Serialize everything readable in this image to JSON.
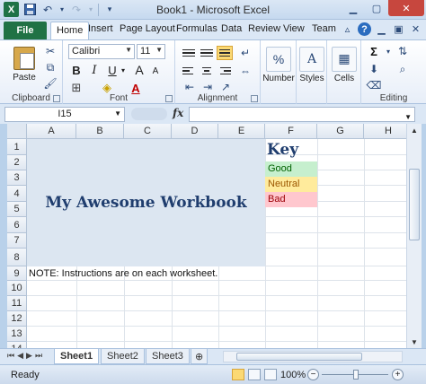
{
  "window": {
    "title": "Book1 - Microsoft Excel",
    "app_icon_letter": "X"
  },
  "tabs": [
    "File",
    "Home",
    "Insert",
    "Page Layout",
    "Formulas",
    "Data",
    "Review",
    "View",
    "Team"
  ],
  "ribbon": {
    "clipboard": {
      "label": "Clipboard",
      "paste_label": "Paste"
    },
    "font": {
      "label": "Font",
      "font_name": "Calibri",
      "font_size": "11",
      "bold": "B",
      "italic": "I",
      "underline": "U",
      "grow": "A",
      "shrink": "A",
      "font_color": "A"
    },
    "alignment": {
      "label": "Alignment"
    },
    "number": {
      "label": "Number",
      "icon_glyph": "%"
    },
    "styles": {
      "label": "Styles",
      "icon_glyph": "A"
    },
    "cells": {
      "label": "Cells"
    },
    "editing": {
      "label": "Editing",
      "sum_glyph": "Σ"
    }
  },
  "formula_bar": {
    "name_box": "I15",
    "fx": "fx",
    "value": ""
  },
  "grid": {
    "columns": [
      "A",
      "B",
      "C",
      "D",
      "E",
      "F",
      "G",
      "H"
    ],
    "rows": [
      "1",
      "2",
      "3",
      "4",
      "5",
      "6",
      "7",
      "8",
      "9",
      "10",
      "11",
      "12",
      "13",
      "14"
    ],
    "title": "My Awesome Workbook",
    "key_title": "Key",
    "key_items": [
      {
        "label": "Good",
        "color": "#c6efce"
      },
      {
        "label": "Neutral",
        "color": "#ffeb9c"
      },
      {
        "label": "Bad",
        "color": "#ffc7ce"
      }
    ],
    "note": "NOTE: Instructions are on each worksheet."
  },
  "sheets": [
    "Sheet1",
    "Sheet2",
    "Sheet3"
  ],
  "status": {
    "ready": "Ready",
    "zoom": "100%"
  }
}
